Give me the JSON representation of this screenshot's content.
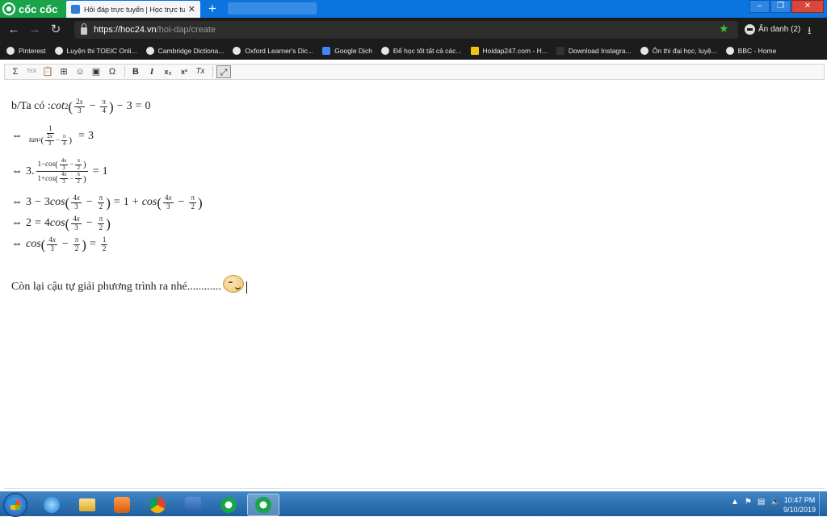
{
  "browser": {
    "brand": "cốc cốc",
    "tab_title": "Hỏi đáp trực tuyến | Học trực tuyến",
    "tab_close": "✕",
    "new_tab": "+",
    "url_host": "https://hoc24.vn",
    "url_path": "/hoi-dap/create",
    "profile_label": "Ẩn danh (2)",
    "window_controls": {
      "minimize": "–",
      "restore": "❐",
      "close": "✕"
    }
  },
  "bookmarks": [
    {
      "label": "Pinterest",
      "icon": "globe-icon"
    },
    {
      "label": "Luyện thi TOEIC Onli...",
      "icon": "globe-icon"
    },
    {
      "label": "Cambridge Dictiona...",
      "icon": "globe-icon"
    },
    {
      "label": "Oxford Learner's Dic...",
      "icon": "globe-icon"
    },
    {
      "label": "Google Dịch",
      "icon": "google-translate-icon"
    },
    {
      "label": "Để học tốt tất cả các...",
      "icon": "globe-icon"
    },
    {
      "label": "Hoidap247.com - H...",
      "icon": "hoidap-icon"
    },
    {
      "label": "Download Instagra...",
      "icon": "download-site-icon"
    },
    {
      "label": "Ôn thi đại học, luyệ...",
      "icon": "globe-icon"
    },
    {
      "label": "BBC - Home",
      "icon": "globe-icon"
    }
  ],
  "toolbar": {
    "sigma": "Σ",
    "tex": "TᴇX",
    "paste": "📋",
    "table": "⊞",
    "emoji": "☺",
    "image": "▣",
    "omega": "Ω",
    "bold": "B",
    "italic": "I",
    "subscript": "x₂",
    "superscript": "x²",
    "clear_format": "Tx",
    "maximize": "⤢"
  },
  "content": {
    "line1_prefix": "b/Ta có :",
    "closing_text": "Còn lại cậu tự giải phương trình ra nhé............"
  },
  "taskbar": {
    "time": "10:47 PM",
    "date": "9/10/2019",
    "tray_up": "▲"
  }
}
